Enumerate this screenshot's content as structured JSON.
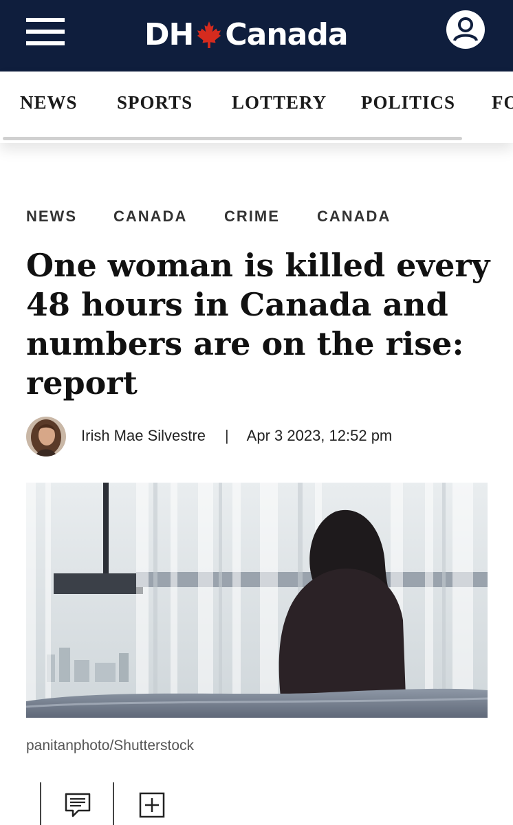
{
  "header": {
    "logo_left": "DH",
    "logo_right": "Canada",
    "menu_icon": "hamburger-menu-icon",
    "maple_icon": "maple-leaf-icon",
    "account_icon": "user-account-icon"
  },
  "nav": {
    "items": [
      "NEWS",
      "SPORTS",
      "LOTTERY",
      "POLITICS",
      "FOOD"
    ]
  },
  "article": {
    "tags": [
      "NEWS",
      "CANADA",
      "CRIME",
      "CANADA"
    ],
    "headline": "One woman is killed every 48 hours in Canada and numbers are on the rise: report",
    "author": "Irish Mae Silvestre",
    "separator": "|",
    "date": "Apr 3 2023, 12:52 pm",
    "photo_credit": "panitanphoto/Shutterstock"
  },
  "tools": {
    "comment_icon": "comment-icon",
    "add_icon": "add-icon"
  },
  "colors": {
    "header_bg": "#0f1e3d",
    "maple_red": "#d52b1e"
  }
}
